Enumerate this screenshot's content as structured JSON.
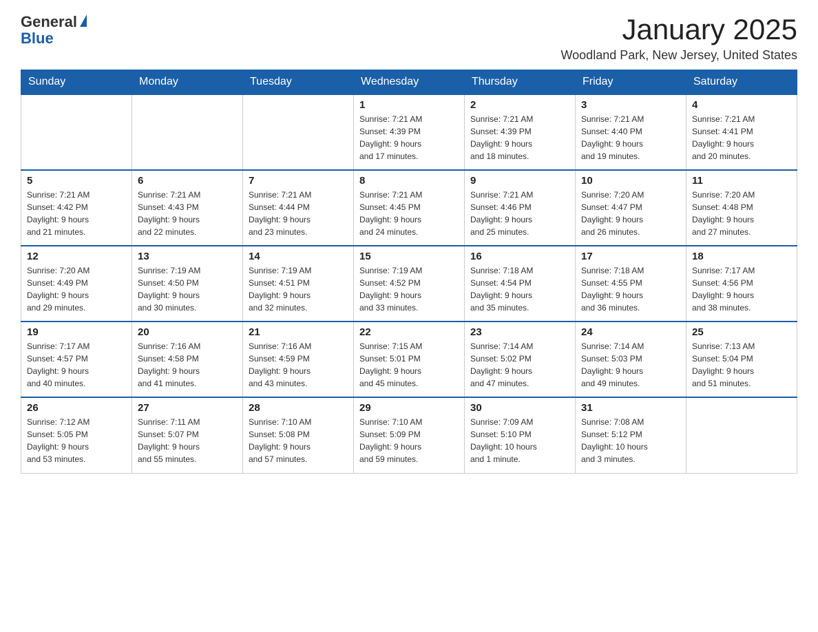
{
  "logo": {
    "text_general": "General",
    "text_blue": "Blue",
    "triangle_alt": "logo triangle"
  },
  "header": {
    "title": "January 2025",
    "subtitle": "Woodland Park, New Jersey, United States"
  },
  "days_of_week": [
    "Sunday",
    "Monday",
    "Tuesday",
    "Wednesday",
    "Thursday",
    "Friday",
    "Saturday"
  ],
  "weeks": [
    [
      {
        "day": "",
        "info": ""
      },
      {
        "day": "",
        "info": ""
      },
      {
        "day": "",
        "info": ""
      },
      {
        "day": "1",
        "info": "Sunrise: 7:21 AM\nSunset: 4:39 PM\nDaylight: 9 hours\nand 17 minutes."
      },
      {
        "day": "2",
        "info": "Sunrise: 7:21 AM\nSunset: 4:39 PM\nDaylight: 9 hours\nand 18 minutes."
      },
      {
        "day": "3",
        "info": "Sunrise: 7:21 AM\nSunset: 4:40 PM\nDaylight: 9 hours\nand 19 minutes."
      },
      {
        "day": "4",
        "info": "Sunrise: 7:21 AM\nSunset: 4:41 PM\nDaylight: 9 hours\nand 20 minutes."
      }
    ],
    [
      {
        "day": "5",
        "info": "Sunrise: 7:21 AM\nSunset: 4:42 PM\nDaylight: 9 hours\nand 21 minutes."
      },
      {
        "day": "6",
        "info": "Sunrise: 7:21 AM\nSunset: 4:43 PM\nDaylight: 9 hours\nand 22 minutes."
      },
      {
        "day": "7",
        "info": "Sunrise: 7:21 AM\nSunset: 4:44 PM\nDaylight: 9 hours\nand 23 minutes."
      },
      {
        "day": "8",
        "info": "Sunrise: 7:21 AM\nSunset: 4:45 PM\nDaylight: 9 hours\nand 24 minutes."
      },
      {
        "day": "9",
        "info": "Sunrise: 7:21 AM\nSunset: 4:46 PM\nDaylight: 9 hours\nand 25 minutes."
      },
      {
        "day": "10",
        "info": "Sunrise: 7:20 AM\nSunset: 4:47 PM\nDaylight: 9 hours\nand 26 minutes."
      },
      {
        "day": "11",
        "info": "Sunrise: 7:20 AM\nSunset: 4:48 PM\nDaylight: 9 hours\nand 27 minutes."
      }
    ],
    [
      {
        "day": "12",
        "info": "Sunrise: 7:20 AM\nSunset: 4:49 PM\nDaylight: 9 hours\nand 29 minutes."
      },
      {
        "day": "13",
        "info": "Sunrise: 7:19 AM\nSunset: 4:50 PM\nDaylight: 9 hours\nand 30 minutes."
      },
      {
        "day": "14",
        "info": "Sunrise: 7:19 AM\nSunset: 4:51 PM\nDaylight: 9 hours\nand 32 minutes."
      },
      {
        "day": "15",
        "info": "Sunrise: 7:19 AM\nSunset: 4:52 PM\nDaylight: 9 hours\nand 33 minutes."
      },
      {
        "day": "16",
        "info": "Sunrise: 7:18 AM\nSunset: 4:54 PM\nDaylight: 9 hours\nand 35 minutes."
      },
      {
        "day": "17",
        "info": "Sunrise: 7:18 AM\nSunset: 4:55 PM\nDaylight: 9 hours\nand 36 minutes."
      },
      {
        "day": "18",
        "info": "Sunrise: 7:17 AM\nSunset: 4:56 PM\nDaylight: 9 hours\nand 38 minutes."
      }
    ],
    [
      {
        "day": "19",
        "info": "Sunrise: 7:17 AM\nSunset: 4:57 PM\nDaylight: 9 hours\nand 40 minutes."
      },
      {
        "day": "20",
        "info": "Sunrise: 7:16 AM\nSunset: 4:58 PM\nDaylight: 9 hours\nand 41 minutes."
      },
      {
        "day": "21",
        "info": "Sunrise: 7:16 AM\nSunset: 4:59 PM\nDaylight: 9 hours\nand 43 minutes."
      },
      {
        "day": "22",
        "info": "Sunrise: 7:15 AM\nSunset: 5:01 PM\nDaylight: 9 hours\nand 45 minutes."
      },
      {
        "day": "23",
        "info": "Sunrise: 7:14 AM\nSunset: 5:02 PM\nDaylight: 9 hours\nand 47 minutes."
      },
      {
        "day": "24",
        "info": "Sunrise: 7:14 AM\nSunset: 5:03 PM\nDaylight: 9 hours\nand 49 minutes."
      },
      {
        "day": "25",
        "info": "Sunrise: 7:13 AM\nSunset: 5:04 PM\nDaylight: 9 hours\nand 51 minutes."
      }
    ],
    [
      {
        "day": "26",
        "info": "Sunrise: 7:12 AM\nSunset: 5:05 PM\nDaylight: 9 hours\nand 53 minutes."
      },
      {
        "day": "27",
        "info": "Sunrise: 7:11 AM\nSunset: 5:07 PM\nDaylight: 9 hours\nand 55 minutes."
      },
      {
        "day": "28",
        "info": "Sunrise: 7:10 AM\nSunset: 5:08 PM\nDaylight: 9 hours\nand 57 minutes."
      },
      {
        "day": "29",
        "info": "Sunrise: 7:10 AM\nSunset: 5:09 PM\nDaylight: 9 hours\nand 59 minutes."
      },
      {
        "day": "30",
        "info": "Sunrise: 7:09 AM\nSunset: 5:10 PM\nDaylight: 10 hours\nand 1 minute."
      },
      {
        "day": "31",
        "info": "Sunrise: 7:08 AM\nSunset: 5:12 PM\nDaylight: 10 hours\nand 3 minutes."
      },
      {
        "day": "",
        "info": ""
      }
    ]
  ]
}
